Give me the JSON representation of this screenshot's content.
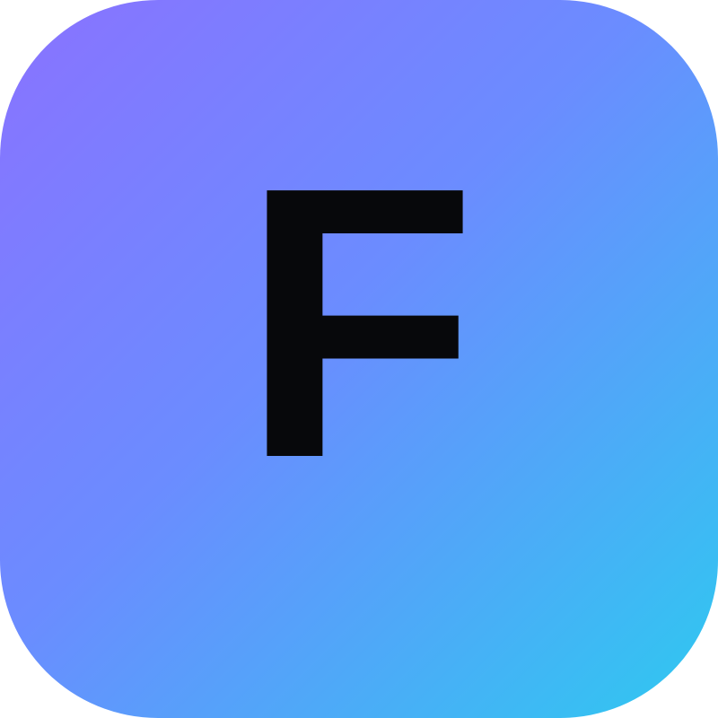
{
  "icon": {
    "letter": "F",
    "semantic": "app-icon",
    "colors": {
      "gradient_start": "#8a72ff",
      "gradient_mid": "#6b8cff",
      "gradient_end": "#2ec9f0",
      "letter": "#07080b"
    }
  }
}
